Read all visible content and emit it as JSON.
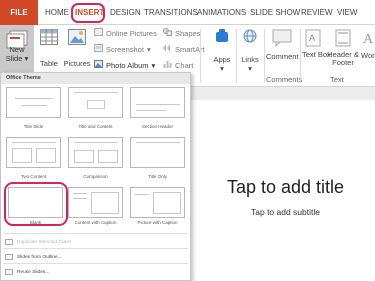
{
  "tabs": {
    "file": "FILE",
    "home": "HOME",
    "insert": "INSERT",
    "design": "DESIGN",
    "transitions": "TRANSITIONS",
    "animations": "ANIMATIONS",
    "slide_show": "SLIDE SHOW",
    "review": "REVIEW",
    "view": "VIEW"
  },
  "ribbon": {
    "new_slide": "New Slide",
    "new_slide_arrow": "▾",
    "table": "Table",
    "pictures": "Pictures",
    "online_pictures": "Online Pictures",
    "screenshot": "Screenshot",
    "screenshot_arrow": "▾",
    "photo_album": "Photo Album",
    "photo_album_arrow": "▾",
    "shapes": "Shapes",
    "smartart": "SmartArt",
    "chart": "Chart",
    "apps": "Apps",
    "apps_arrow": "▾",
    "links": "Links",
    "links_arrow": "▾",
    "comment": "Comment",
    "text_box": "Text Box",
    "header_footer": "Header & Footer",
    "wordart": "Word",
    "group_comments": "Comments",
    "group_text": "Text"
  },
  "layout_panel": {
    "header": "Office Theme",
    "layouts": [
      "Title Slide",
      "Title and Content",
      "Section Header",
      "Two Content",
      "Comparison",
      "Title Only",
      "Blank",
      "Content with Caption",
      "Picture with Caption"
    ],
    "menu": {
      "duplicate": "Duplicate Selected Slides",
      "from_outline": "Slides from Outline...",
      "reuse": "Reuse Slides..."
    }
  },
  "slide": {
    "title_placeholder": "Tap to add title",
    "subtitle_placeholder": "Tap to add subtitle"
  },
  "colors": {
    "file_tab": "#d24726",
    "active_tab": "#d24726",
    "highlight": "#d6245f"
  },
  "icons": [
    "new-slide-icon",
    "table-icon",
    "pictures-icon",
    "online-pictures-icon",
    "screenshot-icon",
    "photo-album-icon",
    "shapes-icon",
    "smartart-icon",
    "chart-icon",
    "apps-icon",
    "links-icon",
    "comment-icon",
    "text-box-icon",
    "header-footer-icon",
    "wordart-icon"
  ]
}
